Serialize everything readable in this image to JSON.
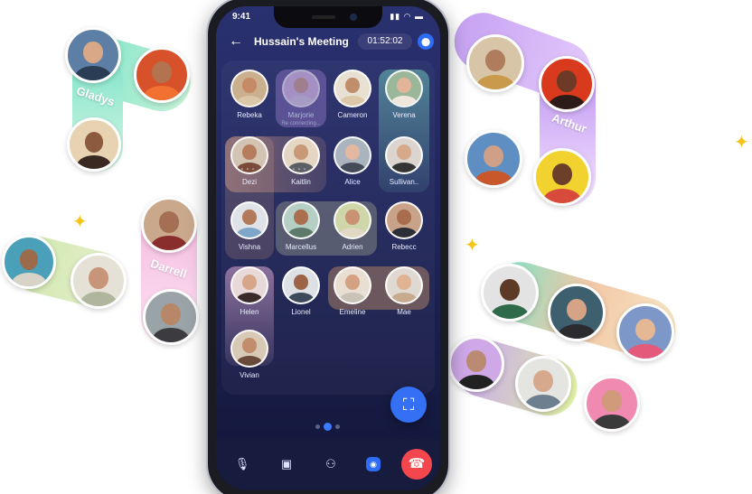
{
  "status_bar": {
    "time": "9:41",
    "icons": "▮▮ ◠ ▬"
  },
  "header": {
    "back_icon": "←",
    "title": "Hussain's Meeting",
    "timer": "01:52:02",
    "lock_icon": "⬤"
  },
  "participants": [
    {
      "name": "Rebeka",
      "status": ""
    },
    {
      "name": "Marjorie",
      "status": "Re connecting..."
    },
    {
      "name": "Cameron",
      "status": ""
    },
    {
      "name": "Verena",
      "status": ""
    },
    {
      "name": "Dezi",
      "status": ""
    },
    {
      "name": "Kaitlin",
      "status": ""
    },
    {
      "name": "Alice",
      "status": ""
    },
    {
      "name": "Sullivan..",
      "status": ""
    },
    {
      "name": "Vishna",
      "status": ""
    },
    {
      "name": "Marcellus",
      "status": ""
    },
    {
      "name": "Adrien",
      "status": ""
    },
    {
      "name": "Rebecc",
      "status": ""
    },
    {
      "name": "Helen",
      "status": ""
    },
    {
      "name": "Lionel",
      "status": ""
    },
    {
      "name": "Emeline",
      "status": ""
    },
    {
      "name": "Mae",
      "status": ""
    },
    {
      "name": "Vivian",
      "status": ""
    }
  ],
  "pagination": {
    "pages": 3,
    "current": 2
  },
  "controls": {
    "mic_icon": "🎙",
    "camera_icon": "▣",
    "add_person_icon": "⚇",
    "share_icon": "◉",
    "end_call_icon": "☎",
    "fab_icon": "⛶"
  },
  "floating_labels": {
    "gladys": "Gladys",
    "arthur": "Arthur",
    "darrell": "Darrell"
  },
  "sparkle": "✦",
  "colors": {
    "accent": "#2f6cf5",
    "end_call": "#f4474d",
    "screen_bg": "#1f2559"
  }
}
